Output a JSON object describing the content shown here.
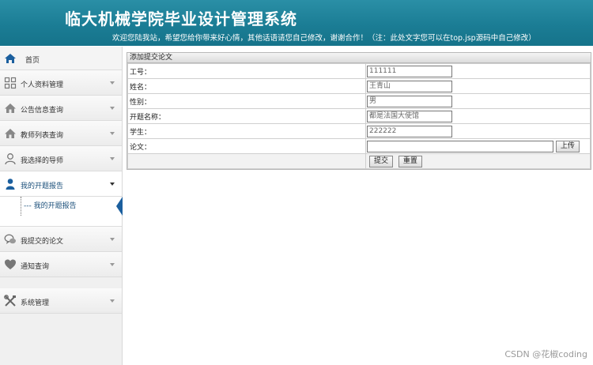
{
  "header": {
    "title": "临大机械学院毕业设计管理系统",
    "marquee": "欢迎您陆我站，希望您给你带来好心情，其他话语请您自己修改，谢谢合作！（注：此处文字您可以在top.jsp源码中自己修改）"
  },
  "sidebar": {
    "home": "首页",
    "items": [
      {
        "label": "个人资料管理",
        "icon": "grid-icon"
      },
      {
        "label": "公告信息查询",
        "icon": "house-icon"
      },
      {
        "label": "教师列表查询",
        "icon": "house-icon"
      },
      {
        "label": "我选择的导师",
        "icon": "user-outline-icon"
      },
      {
        "label": "我的开题报告",
        "icon": "user-icon"
      },
      {
        "label": "我提交的论文",
        "icon": "chat-icon"
      },
      {
        "label": "通知查询",
        "icon": "heart-icon"
      },
      {
        "label": "系统管理",
        "icon": "tools-icon"
      }
    ],
    "submenu": "我的开题报告"
  },
  "form": {
    "title": "添加提交论文",
    "rows": [
      {
        "label": "工号：",
        "value": "111111"
      },
      {
        "label": "姓名：",
        "value": "王青山"
      },
      {
        "label": "性别：",
        "value": "男"
      },
      {
        "label": "开题名称：",
        "value": "都是法国大使馆"
      },
      {
        "label": "学生：",
        "value": "222222"
      },
      {
        "label": "论文：",
        "value": ""
      }
    ],
    "upload_label": "上传",
    "submit_label": "提交",
    "reset_label": "重置"
  },
  "watermark": "CSDN @花椒coding",
  "colors": {
    "header": "#1b7d95",
    "accent": "#1b5f9e"
  }
}
